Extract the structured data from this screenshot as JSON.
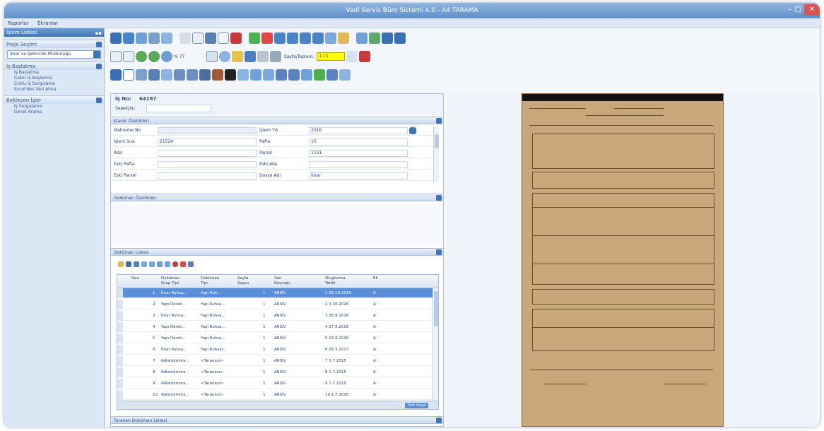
{
  "window": {
    "title": "Vadi Servis Büro Sistemi 4.0 - A4 TARAMA",
    "controls": {
      "minimize": "–",
      "maximize": "□",
      "close": "✕"
    }
  },
  "menu": [
    "Raporlar",
    "Ekranlar"
  ],
  "sidebar": {
    "header": "İşlem Listesi",
    "project_label": "Proje Seçimi",
    "project_value": "İmar ve Şehircilik Müdürlüğü",
    "groups": [
      {
        "title": "İş Başlatma",
        "items": [
          "İş Başlatma",
          "Çoklu İş Başlatma",
          "Çoklu İş Sorgulama",
          "Excel'den Veri Alma"
        ]
      },
      {
        "title": "Bekleyen İşler",
        "items": [
          "İş Sorgulama",
          "Genel Arama"
        ]
      }
    ]
  },
  "toolbar": {
    "zoom": "% 77",
    "page_label": "Sayfa/Toplam:",
    "page_value": "1 / 1"
  },
  "form": {
    "is_no_label": "İş No:",
    "is_no_value": "64167",
    "sepet_label": "Sepetçisi:",
    "sepet_value": "",
    "section_title": "Klasör Özellikleri",
    "fields": [
      {
        "l1": "Mahreme No",
        "v1": "",
        "l2": "İşlem Yılı",
        "v2": "2016"
      },
      {
        "l1": "İşlem Sıra",
        "v1": "21524",
        "l2": "Pafta",
        "v2": "10"
      },
      {
        "l1": "Ada",
        "v1": "",
        "l2": "Parsel",
        "v2": "1151"
      },
      {
        "l1": "Eski Pafta",
        "v1": "",
        "l2": "Eski Ada",
        "v2": ""
      },
      {
        "l1": "Eski Parsel",
        "v1": "",
        "l2": "Dosya Adı",
        "v2": "İmar"
      }
    ],
    "doc_props_title": "Doküman Özellikleri",
    "doc_list_title": "Doküman Listesi",
    "scanned_title": "Taranan Doküman Listesi"
  },
  "grid": {
    "headers": [
      "Sıra",
      "Doküman Grup Tipi",
      "Doküman Tipi",
      "Sayfa Sayısı",
      "Veri Kaynağı",
      "Oluşturma Tarihi",
      "Ek"
    ],
    "rows": [
      {
        "no": "1",
        "grup": "İmar Ruhsa...",
        "tip": "Yapı Ruh...",
        "sayfa": "1",
        "kaynak": "ARSİV",
        "tarih": "1 05.10.2016",
        "ek": "A"
      },
      {
        "no": "2",
        "grup": "Yapı Denet...",
        "tip": "Yapı Ruhsa...",
        "sayfa": "1",
        "kaynak": "ARSİV",
        "tarih": "2 3.10.2016",
        "ek": "A"
      },
      {
        "no": "3",
        "grup": "İmar Ruhsa...",
        "tip": "Yapı Ruhsa...",
        "sayfa": "1",
        "kaynak": "ARSİV",
        "tarih": "3 28.9.2016",
        "ek": "A"
      },
      {
        "no": "4",
        "grup": "Yapı Denet...",
        "tip": "Yapı Ruhsa...",
        "sayfa": "1",
        "kaynak": "ARSİV",
        "tarih": "4 27.9.2016",
        "ek": "A"
      },
      {
        "no": "5",
        "grup": "Yapı Denet...",
        "tip": "Yapı Ruhsa...",
        "sayfa": "1",
        "kaynak": "ARSİV",
        "tarih": "5 23.9.2016",
        "ek": "A"
      },
      {
        "no": "6",
        "grup": "İmar Ruhsa...",
        "tip": "Yapı Ruhsat...",
        "sayfa": "1",
        "kaynak": "ARSİV",
        "tarih": "6 28.3.2017",
        "ek": "A"
      },
      {
        "no": "7",
        "grup": "Adlandırılma...",
        "tip": "<Taranacı>",
        "sayfa": "1",
        "kaynak": "ARSİV",
        "tarih": "7 1.7.2015",
        "ek": "A"
      },
      {
        "no": "8",
        "grup": "Adlandırılma...",
        "tip": "<Taranacı>",
        "sayfa": "1",
        "kaynak": "ARSİV",
        "tarih": "8 1.7.2015",
        "ek": "A"
      },
      {
        "no": "9",
        "grup": "Adlandırılma...",
        "tip": "<Taranacı>",
        "sayfa": "1",
        "kaynak": "ARSİV",
        "tarih": "9 1.7.2015",
        "ek": "A"
      },
      {
        "no": "10",
        "grup": "Adlandırılma...",
        "tip": "<Taranacı>",
        "sayfa": "1",
        "kaynak": "ARSİV",
        "tarih": "10 1.7.2015",
        "ek": "A"
      }
    ],
    "footer_label": "Tüm Kayıt"
  },
  "colors": {
    "accent": "#3f73b5",
    "selection": "#5a8fd6",
    "page_highlight": "#ffff00",
    "paper": "#c9a77a"
  }
}
